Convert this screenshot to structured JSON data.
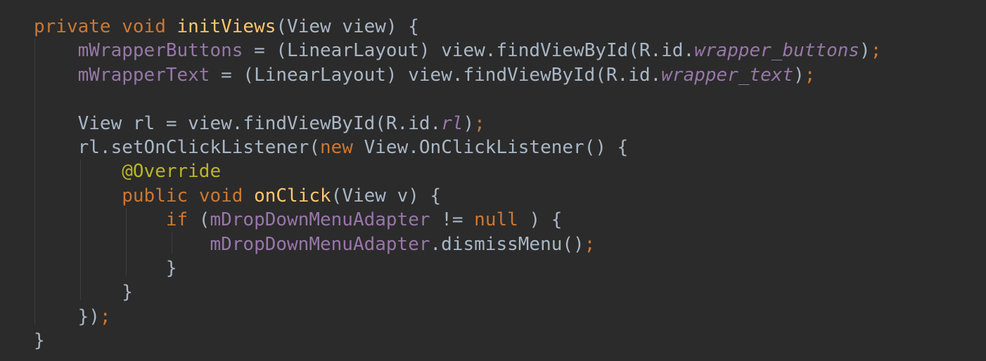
{
  "editor": {
    "background": "#2b2b2b",
    "colors": {
      "keyword": "#cc7832",
      "method_declaration": "#ffc66d",
      "field": "#9876aa",
      "static_constant": "#9876aa",
      "annotation": "#bbb529",
      "default_text": "#a9b7c6",
      "indent_guide": "#3f3f3f"
    },
    "lines": [
      {
        "tokens": [
          {
            "t": "private",
            "c": "kw"
          },
          {
            "t": " ",
            "c": "plain"
          },
          {
            "t": "void",
            "c": "kw"
          },
          {
            "t": " ",
            "c": "plain"
          },
          {
            "t": "initViews",
            "c": "fn"
          },
          {
            "t": "(View view) {",
            "c": "plain"
          }
        ]
      },
      {
        "tokens": [
          {
            "t": "    ",
            "c": "plain"
          },
          {
            "t": "mWrapperButtons",
            "c": "field"
          },
          {
            "t": " = (LinearLayout) view.findViewById(R.id.",
            "c": "plain"
          },
          {
            "t": "wrapper_buttons",
            "c": "const"
          },
          {
            "t": ")",
            "c": "plain"
          },
          {
            "t": ";",
            "c": "semi"
          }
        ]
      },
      {
        "tokens": [
          {
            "t": "    ",
            "c": "plain"
          },
          {
            "t": "mWrapperText",
            "c": "field"
          },
          {
            "t": " = (LinearLayout) view.findViewById(R.id.",
            "c": "plain"
          },
          {
            "t": "wrapper_text",
            "c": "const"
          },
          {
            "t": ")",
            "c": "plain"
          },
          {
            "t": ";",
            "c": "semi"
          }
        ]
      },
      {
        "tokens": []
      },
      {
        "tokens": [
          {
            "t": "    View rl = view.findViewById(R.id.",
            "c": "plain"
          },
          {
            "t": "rl",
            "c": "const"
          },
          {
            "t": ")",
            "c": "plain"
          },
          {
            "t": ";",
            "c": "semi"
          }
        ]
      },
      {
        "tokens": [
          {
            "t": "    rl.setOnClickListener(",
            "c": "plain"
          },
          {
            "t": "new",
            "c": "kw"
          },
          {
            "t": " View.OnClickListener() {",
            "c": "plain"
          }
        ]
      },
      {
        "tokens": [
          {
            "t": "        ",
            "c": "plain"
          },
          {
            "t": "@Override",
            "c": "ann"
          }
        ]
      },
      {
        "tokens": [
          {
            "t": "        ",
            "c": "plain"
          },
          {
            "t": "public",
            "c": "kw"
          },
          {
            "t": " ",
            "c": "plain"
          },
          {
            "t": "void",
            "c": "kw"
          },
          {
            "t": " ",
            "c": "plain"
          },
          {
            "t": "onClick",
            "c": "fn"
          },
          {
            "t": "(View v) {",
            "c": "plain"
          }
        ]
      },
      {
        "tokens": [
          {
            "t": "            ",
            "c": "plain"
          },
          {
            "t": "if",
            "c": "kw"
          },
          {
            "t": " (",
            "c": "plain"
          },
          {
            "t": "mDropDownMenuAdapter",
            "c": "field"
          },
          {
            "t": " != ",
            "c": "plain"
          },
          {
            "t": "null",
            "c": "kw"
          },
          {
            "t": " ) {",
            "c": "plain"
          }
        ]
      },
      {
        "tokens": [
          {
            "t": "                ",
            "c": "plain"
          },
          {
            "t": "mDropDownMenuAdapter",
            "c": "field"
          },
          {
            "t": ".dismissMenu()",
            "c": "plain"
          },
          {
            "t": ";",
            "c": "semi"
          }
        ]
      },
      {
        "tokens": [
          {
            "t": "            }",
            "c": "plain"
          }
        ]
      },
      {
        "tokens": [
          {
            "t": "        }",
            "c": "plain"
          }
        ]
      },
      {
        "tokens": [
          {
            "t": "    })",
            "c": "plain"
          },
          {
            "t": ";",
            "c": "semi"
          }
        ]
      },
      {
        "tokens": [
          {
            "t": "}",
            "c": "plain"
          }
        ]
      }
    ]
  }
}
